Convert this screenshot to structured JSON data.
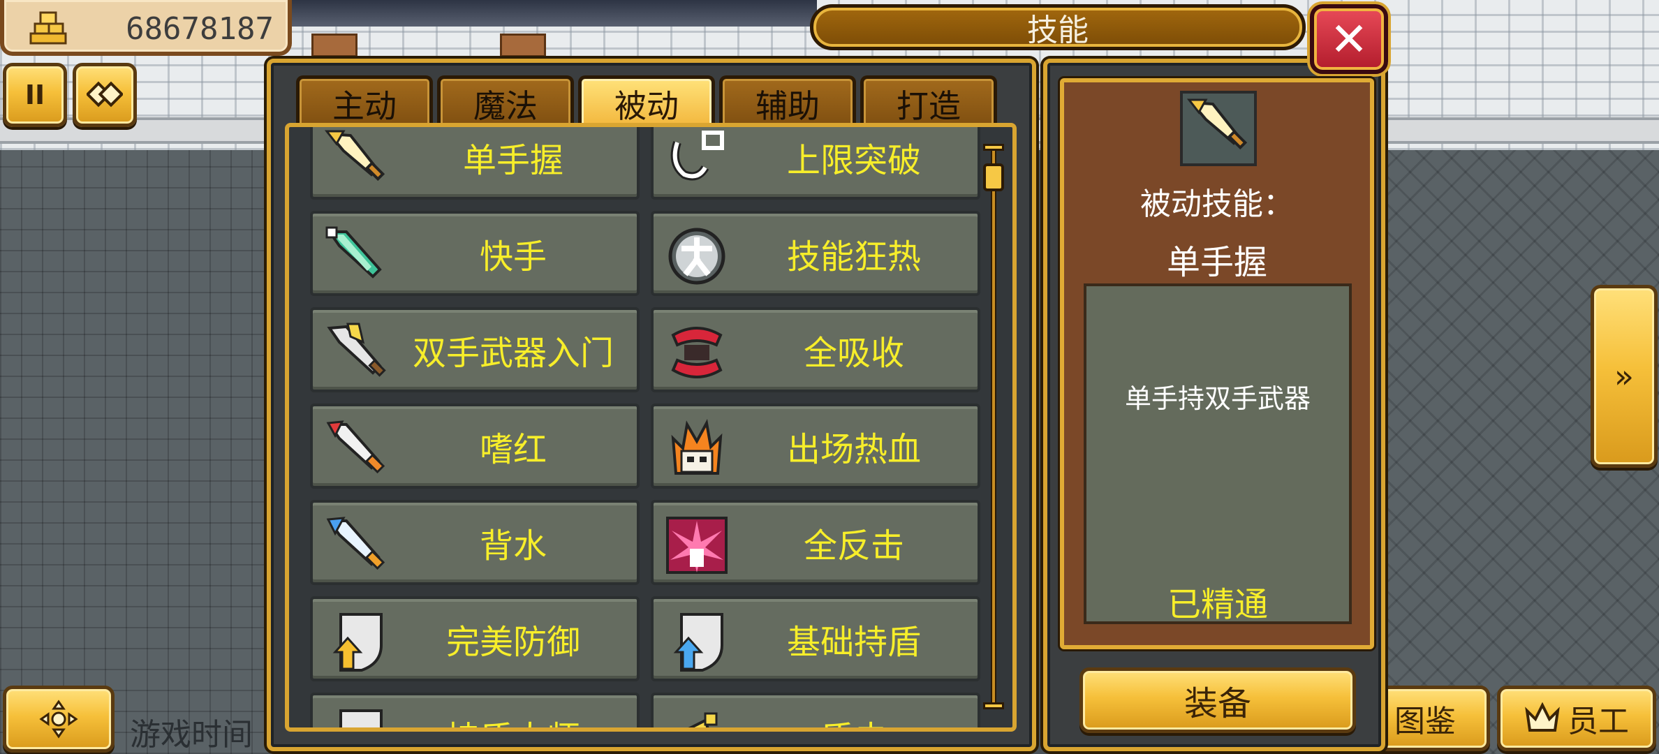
{
  "hud": {
    "money_value": "68678187",
    "money_icon": "gold-bars-icon",
    "pause_label": "II",
    "grid_button_icon": "tile-icon",
    "right_arrow_label": "»",
    "bottom_left_icon": "dpad-icon",
    "game_time_label": "游戏时间",
    "book_label": "图鉴",
    "staff_label": "员工",
    "staff_icon": "crown-icon"
  },
  "dialog": {
    "title": "技能",
    "close_label": "✕"
  },
  "tabs": [
    {
      "label": "主动",
      "active": false
    },
    {
      "label": "魔法",
      "active": false
    },
    {
      "label": "被动",
      "active": true
    },
    {
      "label": "辅助",
      "active": false
    },
    {
      "label": "打造",
      "active": false
    }
  ],
  "skills": [
    {
      "name": "单手握",
      "icon": "sword-gold-icon"
    },
    {
      "name": "上限突破",
      "icon": "chain-break-icon"
    },
    {
      "name": "快手",
      "icon": "sword-green-icon"
    },
    {
      "name": "技能狂热",
      "icon": "runner-orb-icon"
    },
    {
      "name": "双手武器入门",
      "icon": "sword-basic-icon"
    },
    {
      "name": "全吸收",
      "icon": "red-claw-icon"
    },
    {
      "name": "嗜红",
      "icon": "sword-red-icon"
    },
    {
      "name": "出场热血",
      "icon": "fire-skull-icon"
    },
    {
      "name": "背水",
      "icon": "sword-blue-icon"
    },
    {
      "name": "全反击",
      "icon": "burst-icon"
    },
    {
      "name": "完美防御",
      "icon": "shield-gold-arrow-icon"
    },
    {
      "name": "基础持盾",
      "icon": "shield-blue-arrow-icon"
    },
    {
      "name": "持盾大师",
      "icon": "shield-icon"
    },
    {
      "name": "盾击",
      "icon": "shield-bash-icon"
    }
  ],
  "detail": {
    "icon": "sword-gold-icon",
    "type_label": "被动技能：",
    "skill_name": "单手握",
    "description": "单手持双手武器",
    "status": "已精通",
    "equip_label": "装备"
  },
  "colors": {
    "gold": "#d9a531",
    "skill_text": "#f7ee2a",
    "card_bg": "#656c60",
    "detail_bg": "#7b4828"
  }
}
